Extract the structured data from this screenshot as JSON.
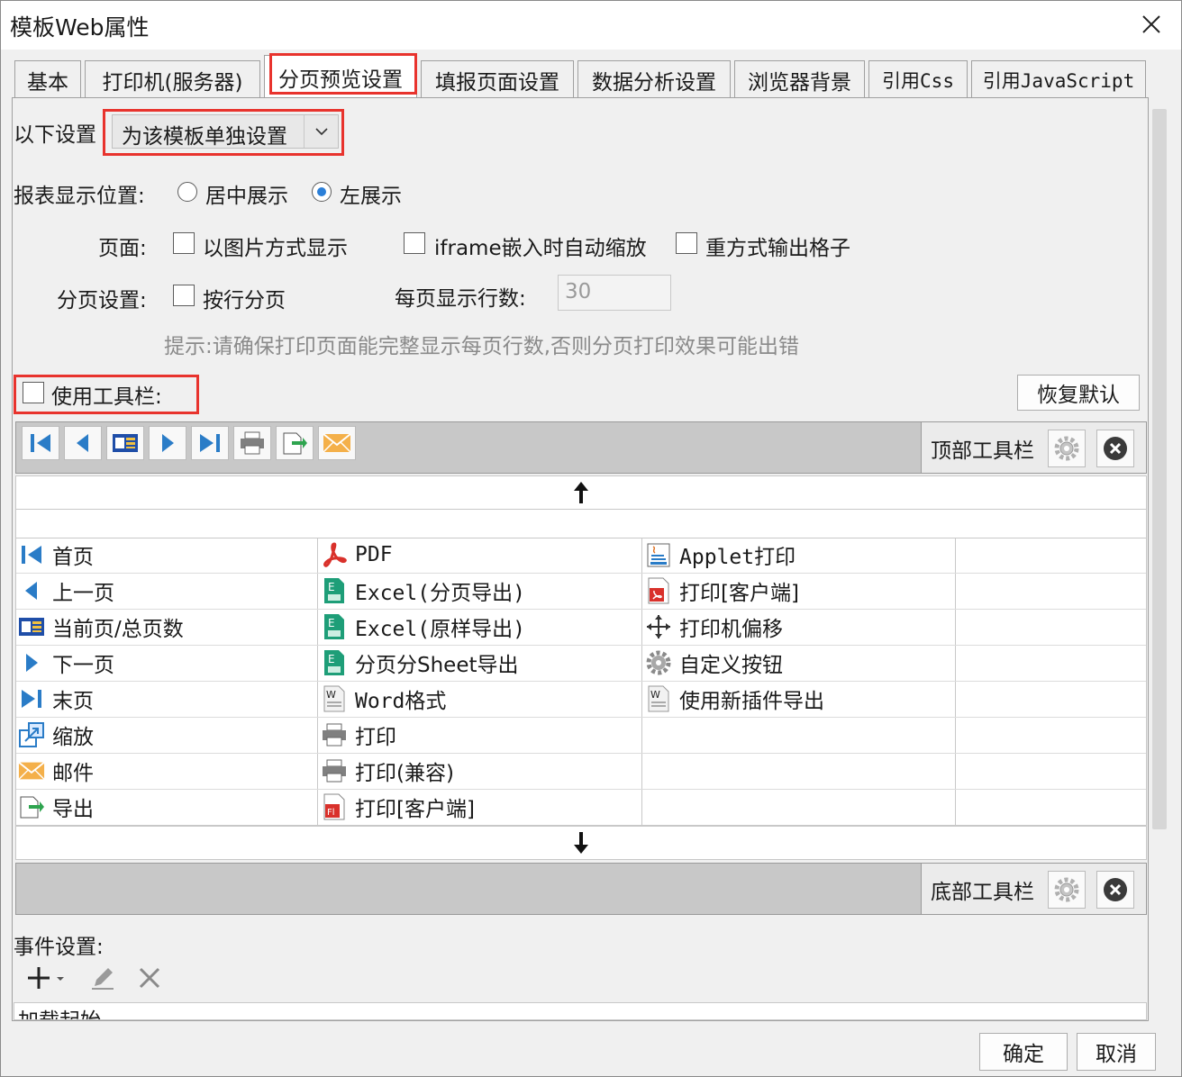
{
  "window": {
    "title": "模板Web属性"
  },
  "tabs": [
    {
      "label": "基本"
    },
    {
      "label": "打印机(服务器)"
    },
    {
      "label": "分页预览设置"
    },
    {
      "label": "填报页面设置"
    },
    {
      "label": "数据分析设置"
    },
    {
      "label": "浏览器背景"
    },
    {
      "label": "引用Css"
    },
    {
      "label": "引用JavaScript"
    }
  ],
  "settings": {
    "mode_label": "以下设置",
    "mode_value": "为该模板单独设置",
    "position_label": "报表显示位置:",
    "position_options": [
      "居中展示",
      "左展示"
    ],
    "page_label": "页面:",
    "page_options": [
      "以图片方式显示",
      "iframe嵌入时自动缩放",
      "重方式输出格子"
    ],
    "paging_label": "分页设置:",
    "paging_option": "按行分页",
    "rows_label": "每页显示行数:",
    "rows_value": "30",
    "hint": "提示:请确保打印页面能完整显示每页行数,否则分页打印效果可能出错"
  },
  "toolbar": {
    "use_label": "使用工具栏:",
    "restore_label": "恢复默认",
    "top_label": "顶部工具栏",
    "bottom_label": "底部工具栏"
  },
  "items": {
    "col1": [
      "首页",
      "上一页",
      "当前页/总页数",
      "下一页",
      "末页",
      "缩放",
      "邮件",
      "导出"
    ],
    "col2": [
      "PDF",
      "Excel(分页导出)",
      "Excel(原样导出)",
      "分页分Sheet导出",
      "Word格式",
      "打印",
      "打印(兼容)",
      "打印[客户端]"
    ],
    "col3": [
      "Applet打印",
      "打印[客户端]",
      "打印机偏移",
      "自定义按钮",
      "使用新插件导出"
    ]
  },
  "events": {
    "label": "事件设置:",
    "first_item": "加载起始"
  },
  "footer": {
    "ok": "确定",
    "cancel": "取消"
  }
}
